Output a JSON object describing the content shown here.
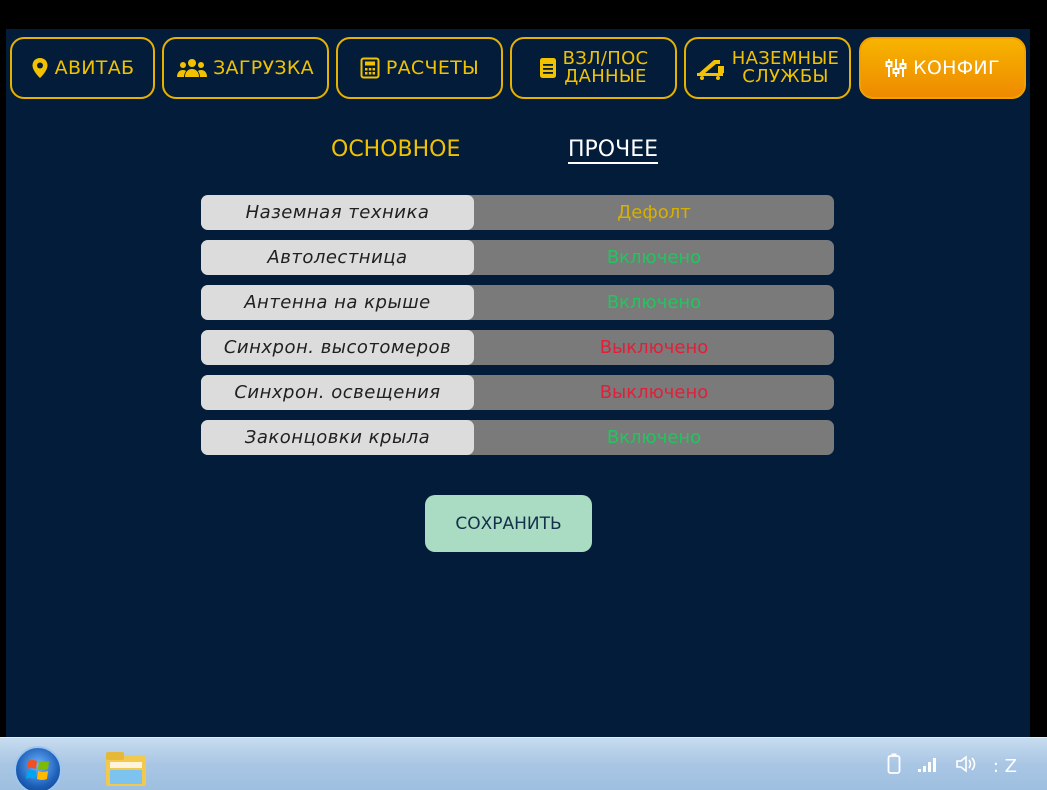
{
  "nav": {
    "tabs": [
      {
        "label": "АВИТАБ",
        "icon": "map-pin-icon"
      },
      {
        "label": "ЗАГРУЗКА",
        "icon": "users-icon"
      },
      {
        "label": "РАСЧЕТЫ",
        "icon": "calculator-icon"
      },
      {
        "line1": "ВЗЛ/ПОС",
        "line2": "ДАННЫЕ",
        "icon": "document-icon"
      },
      {
        "line1": "НАЗЕМНЫЕ",
        "line2": "СЛУЖБЫ",
        "icon": "stairs-truck-icon"
      },
      {
        "label": "КОНФИГ",
        "icon": "sliders-icon",
        "active": true
      }
    ]
  },
  "subtabs": {
    "main": "ОСНОВНОЕ",
    "other": "ПРОЧЕЕ"
  },
  "settings": [
    {
      "name": "Наземная техника",
      "value": "Дефолт",
      "color": "#d8b000"
    },
    {
      "name": "Автолестница",
      "value": "Включено",
      "color": "#22c55e"
    },
    {
      "name": "Антенна на крыше",
      "value": "Включено",
      "color": "#22c55e"
    },
    {
      "name": "Синхрон. высотомеров",
      "value": "Выключено",
      "color": "#e0203a"
    },
    {
      "name": "Синхрон. освещения",
      "value": "Выключено",
      "color": "#e0203a"
    },
    {
      "name": "Законцовки крыла",
      "value": "Включено",
      "color": "#22c55e"
    }
  ],
  "save_label": "СОХРАНИТЬ",
  "taskbar": {
    "clock": ": Z",
    "tray_icons": [
      "battery-icon",
      "signal-icon",
      "volume-icon"
    ]
  },
  "colors": {
    "background": "#021c3a",
    "accent": "#f2c200",
    "active_tab": "#f0a000"
  }
}
